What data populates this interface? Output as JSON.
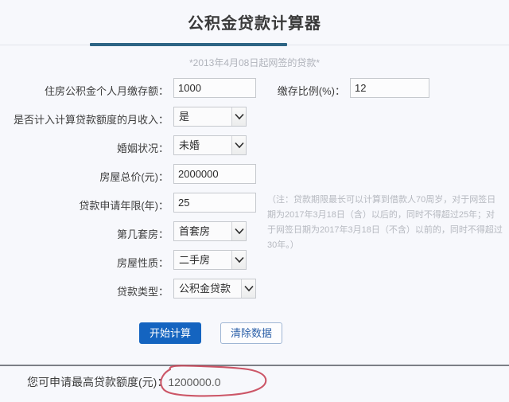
{
  "header": {
    "title": "公积金贷款计算器",
    "subtitle": "*2013年4月08日起网签的贷款*"
  },
  "form": {
    "fields": [
      {
        "id": "monthly-deposit",
        "label": "住房公积金个人月缴存额：",
        "type": "text",
        "value": "1000"
      },
      {
        "id": "deposit-ratio",
        "label": "缴存比例(%)：",
        "type": "text",
        "value": "12"
      },
      {
        "id": "include-income",
        "label": "是否计入计算贷款额度的月收入：",
        "type": "select",
        "value": "是"
      },
      {
        "id": "marital-status",
        "label": "婚姻状况：",
        "type": "select",
        "value": "未婚"
      },
      {
        "id": "house-total-price",
        "label": "房屋总价(元)：",
        "type": "text",
        "value": "2000000"
      },
      {
        "id": "loan-years",
        "label": "贷款申请年限(年)：",
        "type": "text",
        "value": "25"
      },
      {
        "id": "house-order",
        "label": "第几套房：",
        "type": "select",
        "value": "首套房"
      },
      {
        "id": "house-nature",
        "label": "房屋性质：",
        "type": "select",
        "value": "二手房"
      },
      {
        "id": "loan-type",
        "label": "贷款类型：",
        "type": "select",
        "value": "公积金贷款"
      }
    ],
    "note": "（注：贷款期限最长可以计算到借款人70周岁，对于网签日期为2017年3月18日（含）以后的，同时不得超过25年；对于网签日期为2017年3月18日（不含）以前的，同时不得超过30年。）"
  },
  "buttons": {
    "calculate": "开始计算",
    "clear": "清除数据"
  },
  "result": {
    "label": "您可申请最高贷款额度(元)：",
    "value": "1200000.0"
  },
  "icons": {
    "chevron_down": "chevron-down-icon",
    "annotation": "red-ellipse-annotation"
  },
  "colors": {
    "accent": "#1464c0",
    "tab_underline": "#2e6585",
    "background": "#f7f8fc",
    "annotation_red": "#c8485a",
    "muted_text": "#b6b9c0"
  }
}
